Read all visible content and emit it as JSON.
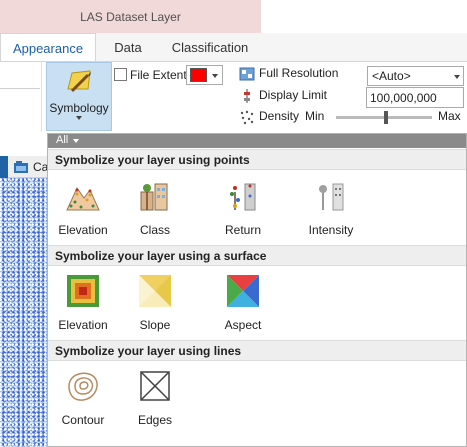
{
  "window": {
    "title": "LAS Dataset Layer"
  },
  "tabs": [
    {
      "label": "Appearance",
      "active": true
    },
    {
      "label": "Data",
      "active": false
    },
    {
      "label": "Classification",
      "active": false
    }
  ],
  "ribbon": {
    "symbology_label": "Symbology",
    "file_extent_label": "File Extent",
    "file_extent_color": "#ff0000",
    "full_resolution_label": "Full Resolution",
    "display_limit_label": "Display Limit",
    "density_label": "Density",
    "min_label": "Min",
    "max_label": "Max",
    "resolution_value": "<Auto>",
    "display_limit_value": "100,000,000",
    "density_level_pct": 52
  },
  "map": {
    "tab_label": "Ca"
  },
  "gallery": {
    "filter_label": "All",
    "sections": [
      {
        "title": "Symbolize your layer using points",
        "items": [
          {
            "label": "Elevation",
            "icon": "elevation-points-icon"
          },
          {
            "label": "Class",
            "icon": "class-icon"
          },
          {
            "label": "Return",
            "icon": "return-icon"
          },
          {
            "label": "Intensity",
            "icon": "intensity-icon"
          }
        ]
      },
      {
        "title": "Symbolize your layer using a surface",
        "items": [
          {
            "label": "Elevation",
            "icon": "elevation-surface-icon"
          },
          {
            "label": "Slope",
            "icon": "slope-icon"
          },
          {
            "label": "Aspect",
            "icon": "aspect-icon"
          }
        ]
      },
      {
        "title": "Symbolize your layer using lines",
        "items": [
          {
            "label": "Contour",
            "icon": "contour-icon"
          },
          {
            "label": "Edges",
            "icon": "edges-icon"
          }
        ]
      }
    ]
  }
}
